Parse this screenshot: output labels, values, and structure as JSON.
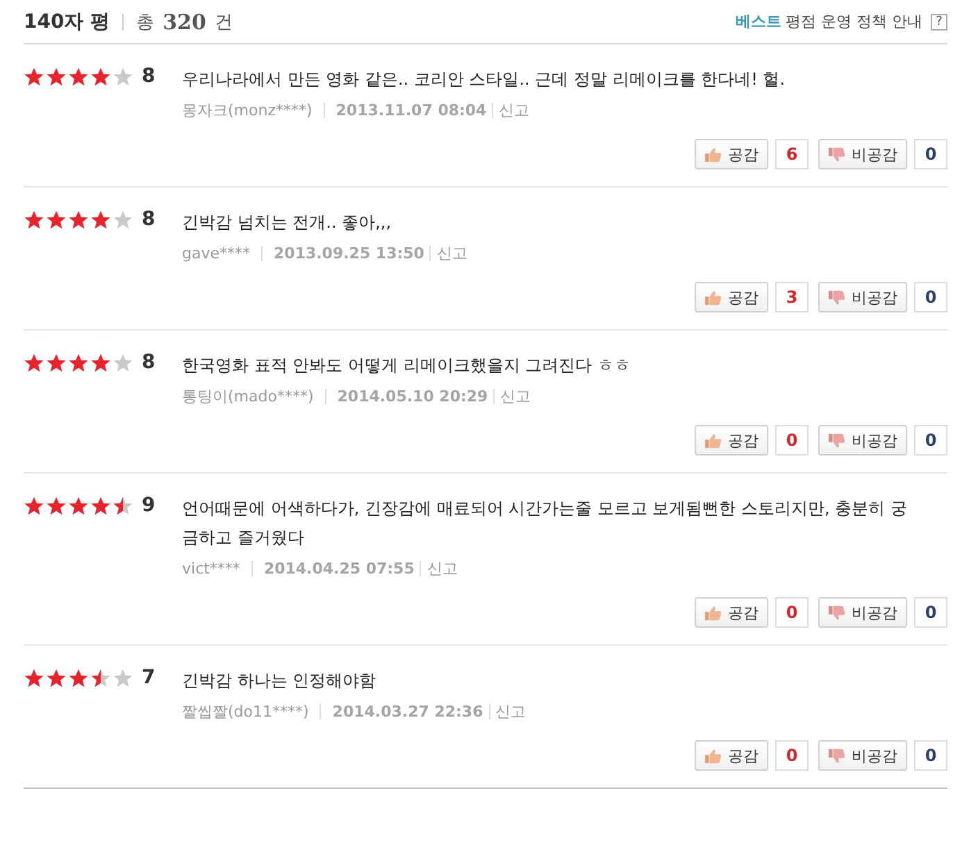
{
  "header": {
    "title": "140자 평",
    "total_prefix": "총",
    "total": "320",
    "total_suffix": "건",
    "policy_highlight": "베스트",
    "policy_text": "평점 운영 정책 안내",
    "help": "?"
  },
  "reviews": [
    {
      "stars": 4,
      "score": "8",
      "comment": "우리나라에서 만든 영화 같은.. 코리안 스타일.. 근데 정말 리메이크를 한다네! 헐.",
      "author": "몽자크(monz****)",
      "date": "2013.11.07 08:04",
      "report": "신고",
      "like_label": "공감",
      "likes": "6",
      "dislike_label": "비공감",
      "dislikes": "0"
    },
    {
      "stars": 4,
      "score": "8",
      "comment": "긴박감 넘치는 전개.. 좋아,,,",
      "author": "gave****",
      "date": "2013.09.25 13:50",
      "report": "신고",
      "like_label": "공감",
      "likes": "3",
      "dislike_label": "비공감",
      "dislikes": "0"
    },
    {
      "stars": 4,
      "score": "8",
      "comment": "한국영화 표적 안봐도 어떻게 리메이크했을지 그려진다 ㅎㅎ",
      "author": "통팅이(mado****)",
      "date": "2014.05.10 20:29",
      "report": "신고",
      "like_label": "공감",
      "likes": "0",
      "dislike_label": "비공감",
      "dislikes": "0"
    },
    {
      "stars": 4.5,
      "score": "9",
      "comment": "언어때문에 어색하다가, 긴장감에 매료되어 시간가는줄 모르고 보게됨뻔한 스토리지만, 충분히 궁금하고 즐거웠다",
      "author": "vict****",
      "date": "2014.04.25 07:55",
      "report": "신고",
      "like_label": "공감",
      "likes": "0",
      "dislike_label": "비공감",
      "dislikes": "0"
    },
    {
      "stars": 3.5,
      "score": "7",
      "comment": "긴박감 하나는 인정해야함",
      "author": "짤씹짤(do11****)",
      "date": "2014.03.27 22:36",
      "report": "신고",
      "like_label": "공감",
      "likes": "0",
      "dislike_label": "비공감",
      "dislikes": "0"
    }
  ]
}
